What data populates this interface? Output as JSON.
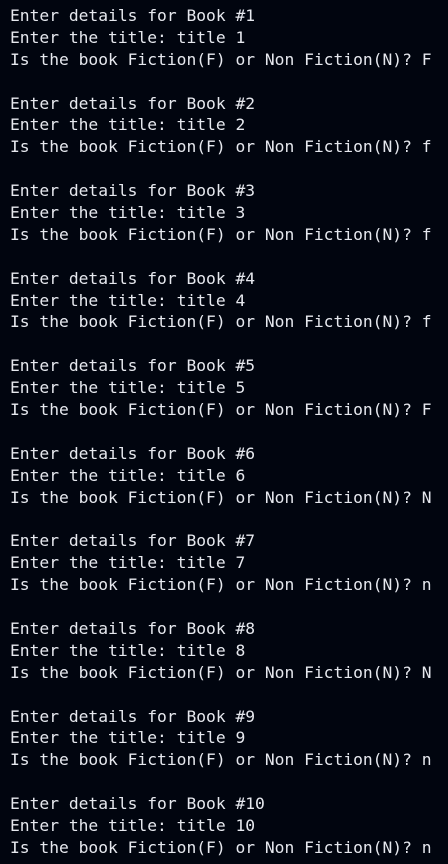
{
  "terminal": {
    "entries": [
      {
        "header": "Enter details for Book #1",
        "title_prompt": "Enter the title: title 1",
        "type_prompt": "Is the book Fiction(F) or Non Fiction(N)? F"
      },
      {
        "header": "Enter details for Book #2",
        "title_prompt": "Enter the title: title 2",
        "type_prompt": "Is the book Fiction(F) or Non Fiction(N)? f"
      },
      {
        "header": "Enter details for Book #3",
        "title_prompt": "Enter the title: title 3",
        "type_prompt": "Is the book Fiction(F) or Non Fiction(N)? f"
      },
      {
        "header": "Enter details for Book #4",
        "title_prompt": "Enter the title: title 4",
        "type_prompt": "Is the book Fiction(F) or Non Fiction(N)? f"
      },
      {
        "header": "Enter details for Book #5",
        "title_prompt": "Enter the title: title 5",
        "type_prompt": "Is the book Fiction(F) or Non Fiction(N)? F"
      },
      {
        "header": "Enter details for Book #6",
        "title_prompt": "Enter the title: title 6",
        "type_prompt": "Is the book Fiction(F) or Non Fiction(N)? N"
      },
      {
        "header": "Enter details for Book #7",
        "title_prompt": "Enter the title: title 7",
        "type_prompt": "Is the book Fiction(F) or Non Fiction(N)? n"
      },
      {
        "header": "Enter details for Book #8",
        "title_prompt": "Enter the title: title 8",
        "type_prompt": "Is the book Fiction(F) or Non Fiction(N)? N"
      },
      {
        "header": "Enter details for Book #9",
        "title_prompt": "Enter the title: title 9",
        "type_prompt": "Is the book Fiction(F) or Non Fiction(N)? n"
      },
      {
        "header": "Enter details for Book #10",
        "title_prompt": "Enter the title: title 10",
        "type_prompt": "Is the book Fiction(F) or Non Fiction(N)? n"
      }
    ]
  },
  "colors": {
    "background": "#01050f",
    "text": "#e6e8ee"
  }
}
